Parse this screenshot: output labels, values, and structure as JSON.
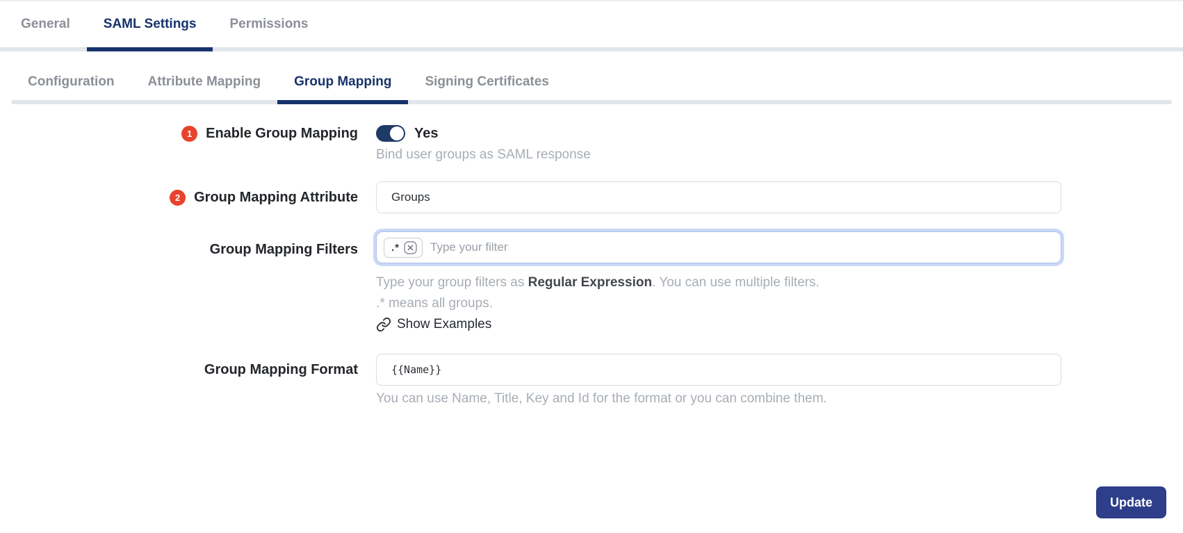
{
  "colors": {
    "accent_navy": "#17336b",
    "toggle_navy": "#1f3a66",
    "button_indigo": "#2d3e8a",
    "badge_red": "#e8432d",
    "helper_gray": "#a7adb5",
    "focus_ring_blue": "#c9d9f6"
  },
  "main_tabs": {
    "items": [
      {
        "label": "General",
        "active": false
      },
      {
        "label": "SAML Settings",
        "active": true
      },
      {
        "label": "Permissions",
        "active": false
      }
    ]
  },
  "sub_tabs": {
    "items": [
      {
        "label": "Configuration",
        "active": false
      },
      {
        "label": "Attribute Mapping",
        "active": false
      },
      {
        "label": "Group Mapping",
        "active": true
      },
      {
        "label": "Signing Certificates",
        "active": false
      }
    ]
  },
  "form": {
    "enable": {
      "badge": "1",
      "label": "Enable Group Mapping",
      "toggle_state": "on",
      "toggle_label": "Yes",
      "helper": "Bind user groups as SAML response"
    },
    "attribute": {
      "badge": "2",
      "label": "Group Mapping Attribute",
      "value": "Groups"
    },
    "filters": {
      "label": "Group Mapping Filters",
      "chip_value": ".*",
      "placeholder": "Type your filter",
      "helper1_prefix": "Type your group filters as ",
      "helper1_strong": "Regular Expression",
      "helper1_suffix": ". You can use multiple filters.",
      "helper2": ".* means all groups.",
      "examples_link": "Show Examples"
    },
    "format": {
      "label": "Group Mapping Format",
      "value": "{{Name}}",
      "helper": "You can use Name, Title, Key and Id for the format or you can combine them."
    }
  },
  "footer": {
    "update_label": "Update"
  }
}
